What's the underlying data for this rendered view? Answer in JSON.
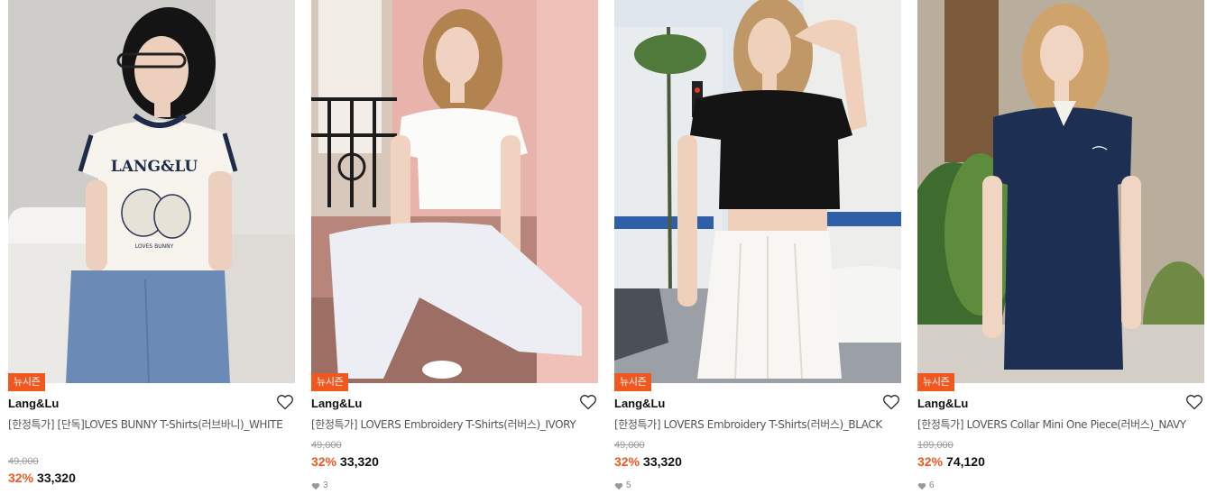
{
  "products": [
    {
      "badge": "뉴시즌",
      "brand": "Lang&Lu",
      "title": "[한정특가] [단독]LOVES BUNNY T-Shirts(러브바니)_WHITE",
      "original_price": "49,000",
      "discount": "32%",
      "price": "33,320",
      "likes": "",
      "shirt_print": "LANG&LU",
      "shirt_sub": "LOVES BUNNY"
    },
    {
      "badge": "뉴시즌",
      "brand": "Lang&Lu",
      "title": "[한정특가] LOVERS Embroidery T-Shirts(러버스)_IVORY",
      "original_price": "49,000",
      "discount": "32%",
      "price": "33,320",
      "likes": "3"
    },
    {
      "badge": "뉴시즌",
      "brand": "Lang&Lu",
      "title": "[한정특가] LOVERS Embroidery T-Shirts(러버스)_BLACK",
      "original_price": "49,000",
      "discount": "32%",
      "price": "33,320",
      "likes": "5"
    },
    {
      "badge": "뉴시즌",
      "brand": "Lang&Lu",
      "title": "[한정특가] LOVERS Collar Mini One Piece(러버스)_NAVY",
      "original_price": "109,000",
      "discount": "32%",
      "price": "74,120",
      "likes": "6"
    }
  ],
  "icons": {
    "wishlist": "heart-outline-icon",
    "likes": "heart-filled-icon"
  },
  "colors": {
    "accent": "#f0581f",
    "badge_bg": "#f0581f",
    "text": "#111111",
    "muted": "#999999"
  }
}
